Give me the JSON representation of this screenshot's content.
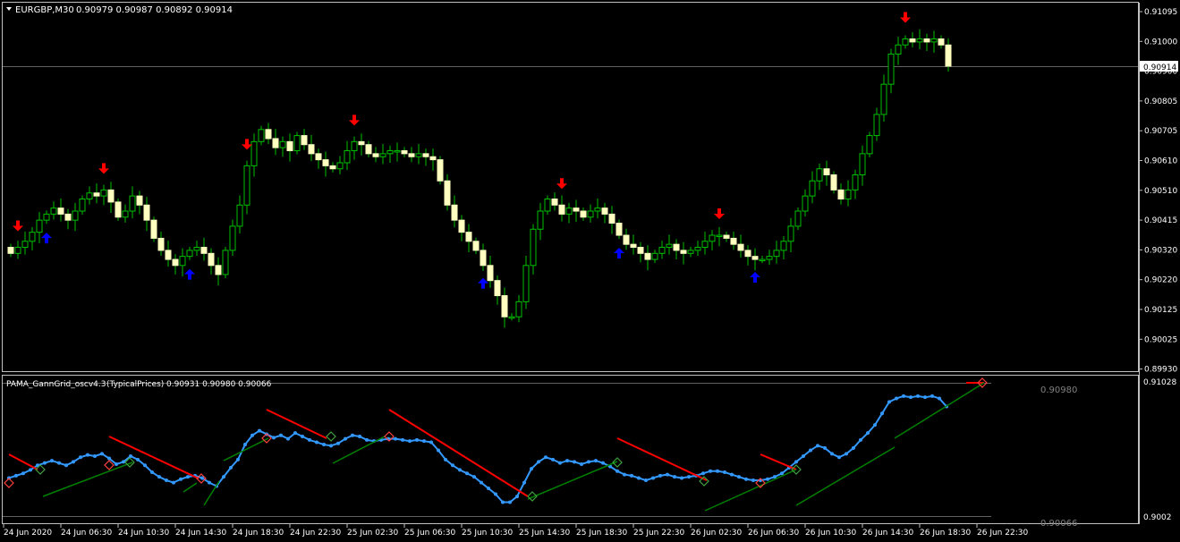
{
  "main_header": {
    "symbol": "EURGBP,M30",
    "ohlc": "0.90979 0.90987 0.90892 0.90914"
  },
  "price_axis": {
    "labels": [
      "0.91095",
      "0.91000",
      "0.90900",
      "0.90805",
      "0.90705",
      "0.90610",
      "0.90510",
      "0.90415",
      "0.90320",
      "0.90220",
      "0.90125",
      "0.90025",
      "0.89930"
    ],
    "current_price": "0.90914"
  },
  "indicator_header": {
    "name": "PAMA_GannGrid_oscv4.3",
    "params": "(TypicalPrices)",
    "values": "0.90931 0.90980 0.90066"
  },
  "indicator_axis": {
    "top_label": "0.91028",
    "bottom_label": "0.9002",
    "level_high": "0.90980",
    "level_low": "0.90066"
  },
  "time_axis": [
    "24 Jun 2020",
    "24 Jun 06:30",
    "24 Jun 10:30",
    "24 Jun 14:30",
    "24 Jun 18:30",
    "24 Jun 22:30",
    "25 Jun 02:30",
    "25 Jun 06:30",
    "25 Jun 10:30",
    "25 Jun 14:30",
    "25 Jun 18:30",
    "25 Jun 22:30",
    "26 Jun 02:30",
    "26 Jun 06:30",
    "26 Jun 10:30",
    "26 Jun 14:30",
    "26 Jun 18:30",
    "26 Jun 22:30"
  ],
  "colors": {
    "bull_candle": "#000000",
    "bear_candle": "#ffffc0",
    "wick": "#00c000",
    "sell_arrow": "#ff0000",
    "buy_arrow": "#0000ff",
    "osc_line": "#3399ff",
    "red_trend": "#ff0000",
    "green_trend": "#008000"
  },
  "chart_data": {
    "type": "candlestick",
    "close_series": [
      0.9029,
      0.9031,
      0.9033,
      0.9036,
      0.904,
      0.9042,
      0.9044,
      0.9042,
      0.904,
      0.9043,
      0.9047,
      0.9049,
      0.9048,
      0.905,
      0.9046,
      0.9041,
      0.9043,
      0.9048,
      0.9045,
      0.904,
      0.9034,
      0.903,
      0.9027,
      0.9025,
      0.9028,
      0.903,
      0.9031,
      0.9029,
      0.9025,
      0.9022,
      0.903,
      0.9038,
      0.9045,
      0.9058,
      0.9066,
      0.907,
      0.9067,
      0.9064,
      0.9066,
      0.9063,
      0.9068,
      0.9065,
      0.9062,
      0.906,
      0.9058,
      0.9057,
      0.9059,
      0.9063,
      0.9066,
      0.9065,
      0.9062,
      0.9061,
      0.9062,
      0.9063,
      0.9063,
      0.9062,
      0.9061,
      0.9062,
      0.9061,
      0.906,
      0.9053,
      0.9045,
      0.904,
      0.9036,
      0.9033,
      0.903,
      0.9025,
      0.902,
      0.9015,
      0.9008,
      0.9008,
      0.9013,
      0.9025,
      0.9037,
      0.9043,
      0.9047,
      0.9045,
      0.9042,
      0.9044,
      0.9043,
      0.9041,
      0.9043,
      0.9044,
      0.9042,
      0.9039,
      0.9035,
      0.9032,
      0.9031,
      0.9029,
      0.9027,
      0.9029,
      0.9031,
      0.9032,
      0.903,
      0.9029,
      0.903,
      0.9031,
      0.9033,
      0.9035,
      0.9035,
      0.9034,
      0.9032,
      0.903,
      0.9028,
      0.9027,
      0.9027,
      0.9028,
      0.903,
      0.9033,
      0.9038,
      0.9043,
      0.9048,
      0.9053,
      0.9057,
      0.9055,
      0.905,
      0.9047,
      0.905,
      0.9055,
      0.9062,
      0.9068,
      0.9075,
      0.9085,
      0.9095,
      0.9098,
      0.91,
      0.9099,
      0.91,
      0.9099,
      0.91,
      0.9098,
      0.9091
    ],
    "sell_signals": [
      1,
      13,
      33,
      48,
      77,
      99,
      125
    ],
    "buy_signals": [
      5,
      25,
      66,
      85,
      104
    ],
    "ylim": [
      0.899,
      0.9112
    ]
  }
}
